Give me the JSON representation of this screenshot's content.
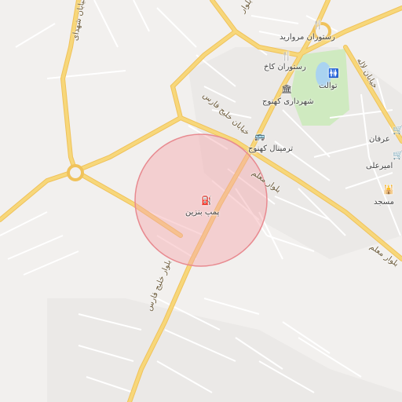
{
  "map": {
    "places": {
      "restaurant_morvarid": "رستوران مروارید",
      "restaurant_kakh": "رستوران کاخ",
      "toilet": "توالت",
      "municipality": "شهرداری کهنوج",
      "terminal": "ترمینال کهنوج",
      "gas_station": "پمپ بنزین",
      "irfan": "عرفان",
      "amir_ali": "امیرعلی",
      "mosque": "مسجد"
    },
    "roads": {
      "khalij_fars_blvd": "بلوار خلیج فارس",
      "khalij_fars_st": "خیابان خلیج فارس",
      "moallem_blvd_1": "بلوار معلم",
      "moallem_blvd_2": "بلوار معلم",
      "lale_st": "خیابان لاله",
      "top_left_road": "خیابان شهدای",
      "top_center_road": "بلوار"
    },
    "icons": {
      "restaurant": "fork-knife-icon",
      "toilet": "toilet-icon",
      "municipality": "government-building-icon",
      "terminal": "bus-icon",
      "gas_station": "fuel-pump-icon",
      "shop": "cart-icon",
      "mosque": "mosque-icon"
    },
    "colors": {
      "background": "#f2f0ee",
      "major_road": "#f7d77a",
      "minor_road": "#ffffff",
      "park": "#cfeac0",
      "water": "#aad3f0",
      "highlight_circle": "#f4a6ab"
    }
  }
}
